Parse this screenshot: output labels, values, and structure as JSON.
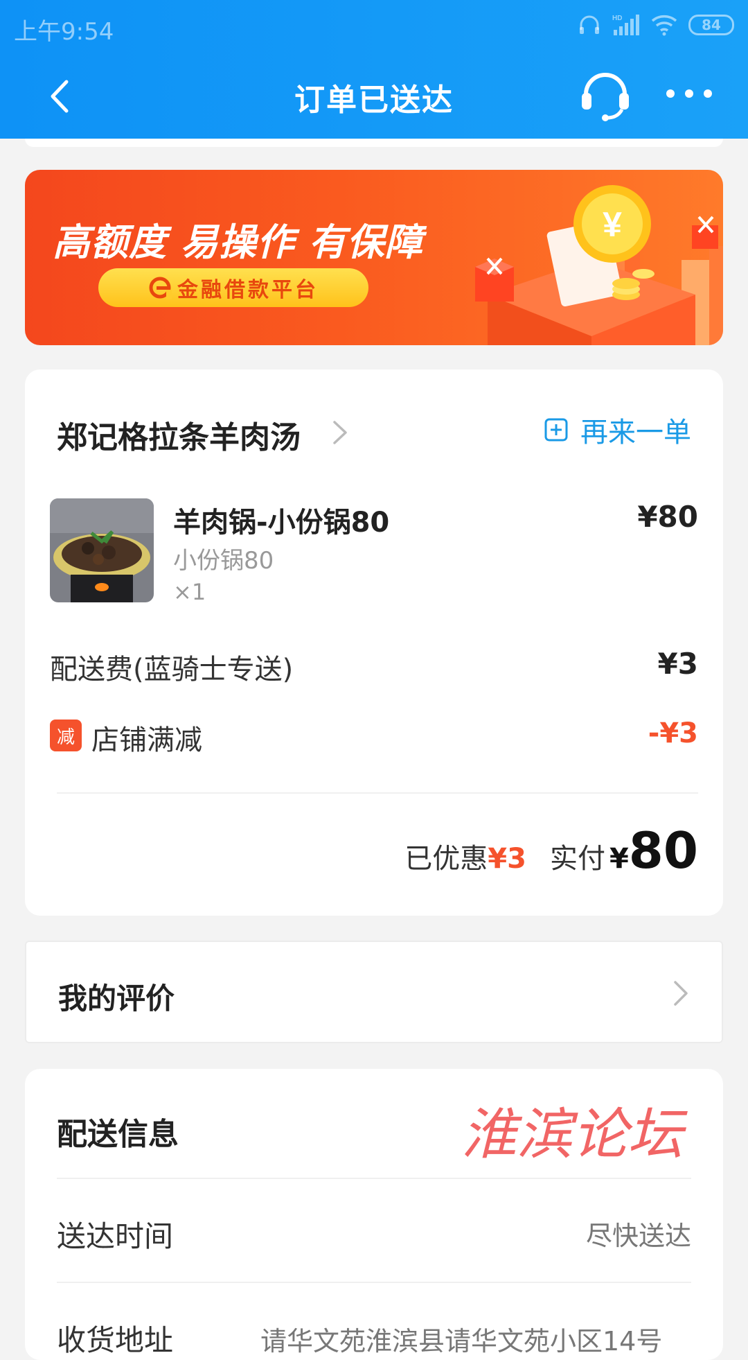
{
  "status_bar": {
    "time": "上午9:54",
    "network": "HD",
    "battery": "84"
  },
  "nav": {
    "title": "订单已送达",
    "back_icon": "chevron-left-icon",
    "service_icon": "headset-icon",
    "more_icon": "more-dots-icon"
  },
  "banner": {
    "headline": "高额度 易操作 有保障",
    "pill": "金融借款平台",
    "pill_logo": "e-logo-icon",
    "coin_symbol": "¥"
  },
  "order": {
    "shop_name": "郑记格拉条羊肉汤",
    "reorder_label": "再来一单",
    "item": {
      "name": "羊肉锅-小份锅80",
      "spec": "小份锅80",
      "qty": "×1",
      "price": "¥80"
    },
    "delivery_fee_label": "配送费(蓝骑士专送)",
    "delivery_fee": "¥3",
    "discount_tag": "减",
    "discount_label": "店铺满减",
    "discount_value": "-¥3",
    "saved_label": "已优惠",
    "saved_value": "¥3",
    "paid_label": "实付",
    "paid_currency": "¥",
    "paid_value": "80"
  },
  "review": {
    "label": "我的评价"
  },
  "delivery_info": {
    "title": "配送信息",
    "watermark": "淮滨论坛",
    "time_label": "送达时间",
    "time_value": "尽快送达",
    "address_label": "收货地址",
    "address_value": "请华文苑淮滨县请华文苑小区14号"
  },
  "colors": {
    "header_blue": "#0e92f6",
    "accent_blue": "#1a9ae6",
    "discount_red": "#f5522c",
    "banner_orange": "#fa5a1f"
  }
}
